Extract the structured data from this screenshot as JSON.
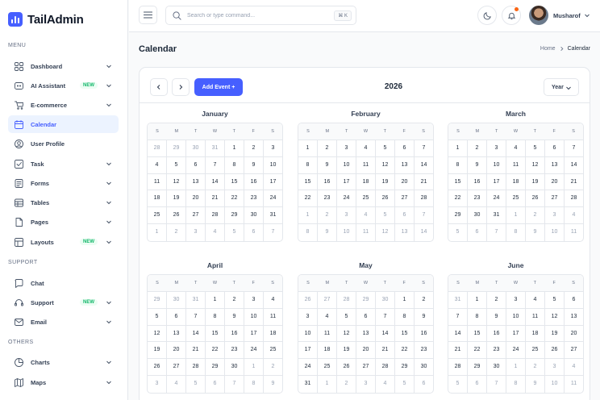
{
  "app": {
    "name": "TailAdmin"
  },
  "sidebar": {
    "sections": [
      "MENU",
      "SUPPORT",
      "OTHERS"
    ],
    "items": [
      {
        "label": "Dashboard",
        "icon": "grid-icon",
        "chevron": true,
        "badge": ""
      },
      {
        "label": "AI Assistant",
        "icon": "ai-icon",
        "chevron": true,
        "badge": "NEW"
      },
      {
        "label": "E-commerce",
        "icon": "cart-icon",
        "chevron": true,
        "badge": ""
      },
      {
        "label": "Calendar",
        "icon": "calendar-icon",
        "chevron": false,
        "badge": "",
        "active": true
      },
      {
        "label": "User Profile",
        "icon": "user-icon",
        "chevron": false,
        "badge": ""
      },
      {
        "label": "Task",
        "icon": "task-icon",
        "chevron": true,
        "badge": ""
      },
      {
        "label": "Forms",
        "icon": "forms-icon",
        "chevron": true,
        "badge": ""
      },
      {
        "label": "Tables",
        "icon": "table-icon",
        "chevron": true,
        "badge": ""
      },
      {
        "label": "Pages",
        "icon": "pages-icon",
        "chevron": true,
        "badge": ""
      },
      {
        "label": "Layouts",
        "icon": "layout-icon",
        "chevron": true,
        "badge": "NEW"
      },
      {
        "label": "Chat",
        "icon": "chat-icon",
        "chevron": false,
        "badge": ""
      },
      {
        "label": "Support",
        "icon": "headset-icon",
        "chevron": true,
        "badge": "NEW"
      },
      {
        "label": "Email",
        "icon": "mail-icon",
        "chevron": true,
        "badge": ""
      },
      {
        "label": "Charts",
        "icon": "pie-chart-icon",
        "chevron": true,
        "badge": ""
      },
      {
        "label": "Maps",
        "icon": "map-icon",
        "chevron": true,
        "badge": ""
      }
    ]
  },
  "header": {
    "search_placeholder": "Search or type command...",
    "shortcut": "⌘ K",
    "user_name": "Musharof"
  },
  "page": {
    "title": "Calendar",
    "breadcrumb": [
      "Home",
      "Calendar"
    ]
  },
  "calendar": {
    "add_label": "Add Event +",
    "year": "2026",
    "view": "Year",
    "weekdays": [
      "S",
      "M",
      "T",
      "W",
      "T",
      "F",
      "S"
    ],
    "months": [
      {
        "name": "January",
        "lead": [
          28,
          29,
          30,
          31
        ],
        "days": 31,
        "weeks": 6
      },
      {
        "name": "February",
        "lead": [],
        "days": 28,
        "weeks": 6
      },
      {
        "name": "March",
        "lead": [],
        "days": 31,
        "weeks": 6
      },
      {
        "name": "April",
        "lead": [
          29,
          30,
          31
        ],
        "days": 30,
        "weeks": 6
      },
      {
        "name": "May",
        "lead": [
          26,
          27,
          28,
          29,
          30
        ],
        "days": 31,
        "weeks": 6
      },
      {
        "name": "June",
        "lead": [
          31
        ],
        "days": 30,
        "weeks": 6
      }
    ]
  },
  "colors": {
    "accent": "#465fff",
    "badge": "#12b76a",
    "notification": "#fb6514"
  }
}
